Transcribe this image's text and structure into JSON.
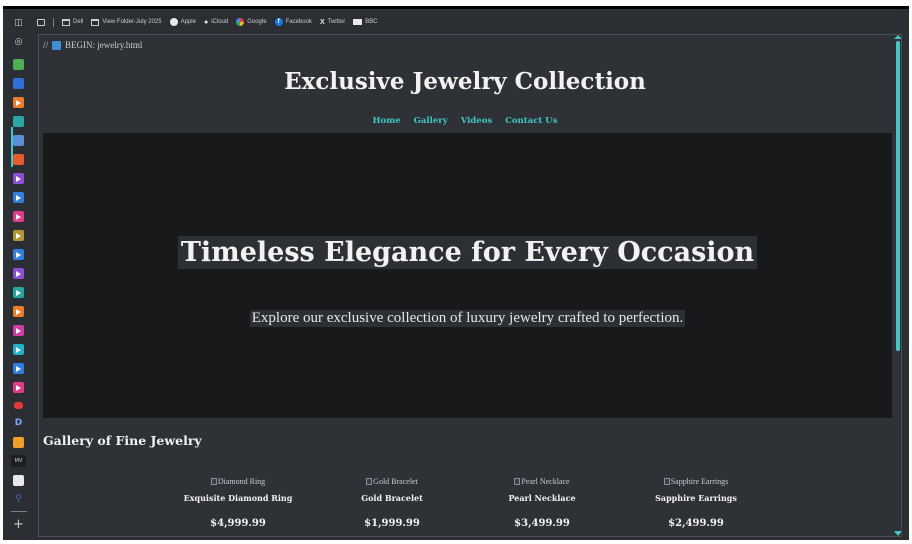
{
  "bookmarks": {
    "items": [
      {
        "label": "Dell",
        "icon": "folder-icon"
      },
      {
        "label": "View Folder-July 2025",
        "icon": "folder-icon"
      },
      {
        "label": "Apple",
        "icon": "apple-icon"
      },
      {
        "label": "iCloud",
        "icon": "apple-icon"
      },
      {
        "label": "Google",
        "icon": "google-icon"
      },
      {
        "label": "Facebook",
        "icon": "facebook-icon"
      },
      {
        "label": "Twitter",
        "icon": "x-icon"
      },
      {
        "label": "BBC",
        "icon": "bbc-icon"
      }
    ]
  },
  "editor": {
    "code_prefix": "//",
    "code_label": "BEGIN: jewelry.html"
  },
  "page": {
    "site_title": "Exclusive Jewelry Collection",
    "nav": [
      "Home",
      "Gallery",
      "Videos",
      "Contact Us"
    ],
    "hero_title": "Timeless Elegance for Every Occasion",
    "hero_subtitle": "Explore our exclusive collection of luxury jewelry crafted to perfection.",
    "gallery_title": "Gallery of Fine Jewelry",
    "products": [
      {
        "alt": "Diamond Ring",
        "name": "Exquisite Diamond Ring",
        "price": "$4,999.99"
      },
      {
        "alt": "Gold Bracelet",
        "name": "Gold Bracelet",
        "price": "$1,999.99"
      },
      {
        "alt": "Pearl Necklace",
        "name": "Pearl Necklace",
        "price": "$3,499.99"
      },
      {
        "alt": "Sapphire Earrings",
        "name": "Sapphire Earrings",
        "price": "$2,499.99"
      }
    ]
  },
  "sidebar": {
    "app_icons": [
      {
        "name": "sidebar-icon",
        "color": "#c9ccd1"
      },
      {
        "name": "globe-icon",
        "color": "#c9ccd1"
      },
      {
        "name": "app-green-icon",
        "color": "#4caf50"
      },
      {
        "name": "app-blue-icon",
        "color": "#2e6fd8"
      },
      {
        "name": "app-orange-icon",
        "color": "#f07c28"
      },
      {
        "name": "app-teal-icon",
        "color": "#2aa6a6"
      },
      {
        "name": "app-multi-icon",
        "color": "#5b8dd9"
      },
      {
        "name": "app-red-orange-icon",
        "color": "#e85a2c"
      },
      {
        "name": "play-purple-icon",
        "color": "#8e4fd8"
      },
      {
        "name": "play-blue-icon",
        "color": "#2f7fe0"
      },
      {
        "name": "play-pink-icon",
        "color": "#e03a8a"
      },
      {
        "name": "play-olive-icon",
        "color": "#b5962e"
      },
      {
        "name": "play-blue2-icon",
        "color": "#2f7fe0"
      },
      {
        "name": "play-violet-icon",
        "color": "#8e4fd8"
      },
      {
        "name": "play-teal-icon",
        "color": "#22a8a0"
      },
      {
        "name": "play-orange-icon",
        "color": "#f07c28"
      },
      {
        "name": "play-magenta-icon",
        "color": "#d23aa8"
      },
      {
        "name": "play-cyan-icon",
        "color": "#1fb3c9"
      },
      {
        "name": "play-blue3-icon",
        "color": "#2f7fe0"
      },
      {
        "name": "play-fuchsia-icon",
        "color": "#e03a8a"
      },
      {
        "name": "youtube-icon",
        "color": "#e53935"
      },
      {
        "name": "d-icon",
        "color": "#7aa7ff"
      },
      {
        "name": "app-amber-icon",
        "color": "#f0a028"
      },
      {
        "name": "mv-icon",
        "color": "#c9ccd1"
      },
      {
        "name": "v-icon",
        "color": "#e9e9e9"
      },
      {
        "name": "search-icon",
        "color": "#3f6fb6"
      }
    ]
  },
  "colors": {
    "accent": "#3ec7c7",
    "background": "#2e3136",
    "hero_background": "#17191b"
  }
}
